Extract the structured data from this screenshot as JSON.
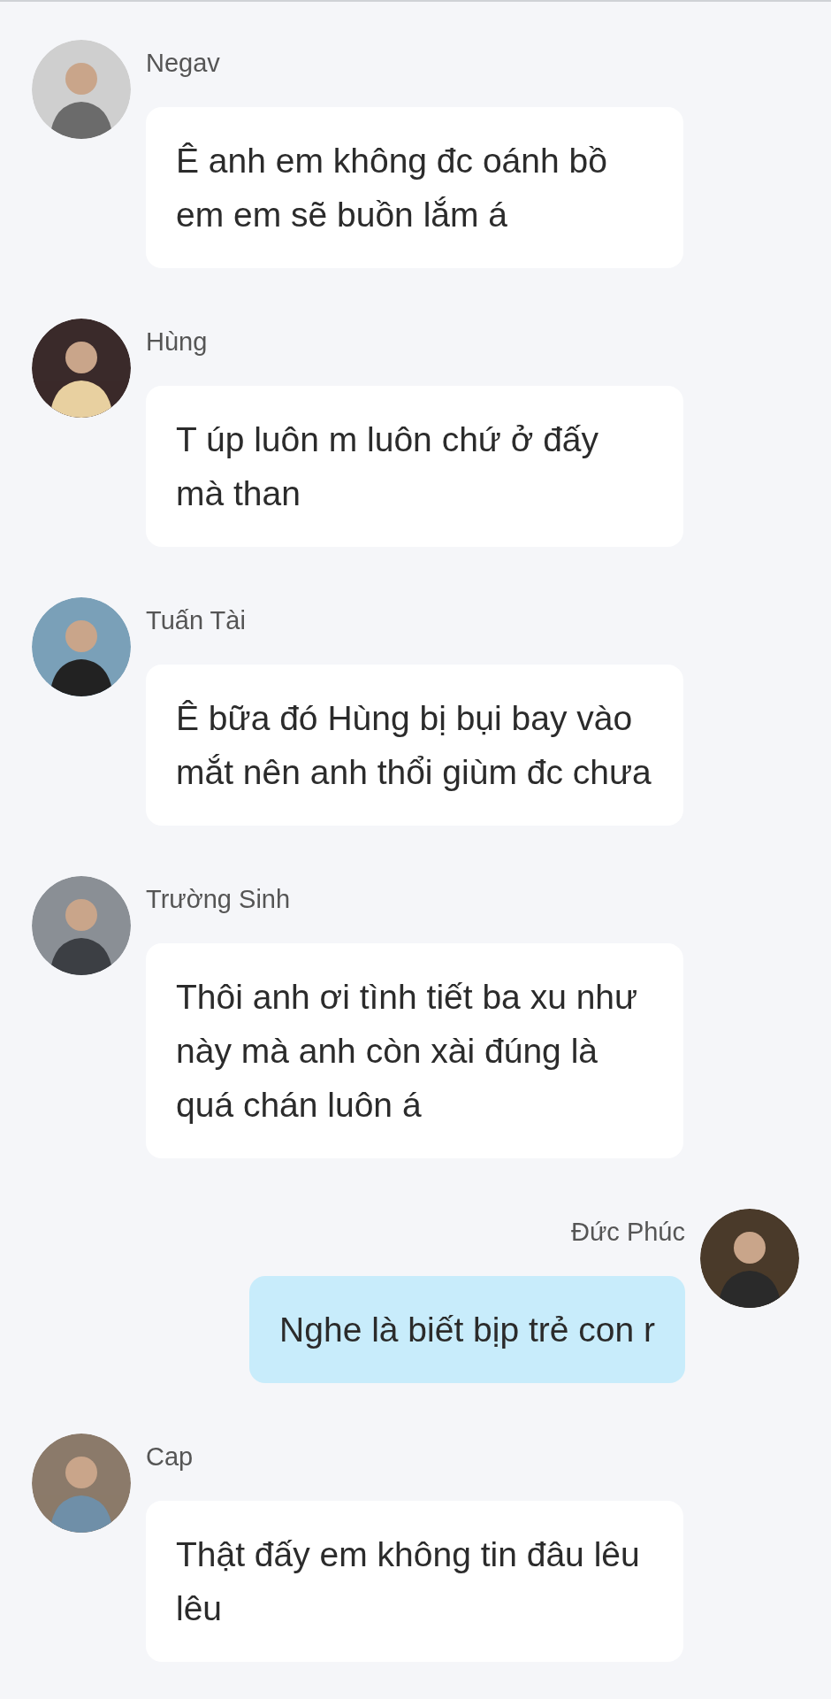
{
  "messages": [
    {
      "kind": "incoming",
      "name": "Negav",
      "text": "Ê anh em không đc oánh bồ em em sẽ buồn lắm á"
    },
    {
      "kind": "incoming",
      "name": "Hùng",
      "text": "T úp luôn m luôn chứ ở đấy mà than"
    },
    {
      "kind": "incoming",
      "name": "Tuấn Tài",
      "text": "Ê bữa đó Hùng bị bụi bay vào mắt nên anh thổi giùm đc chưa"
    },
    {
      "kind": "incoming",
      "name": "Trường Sinh",
      "text": "Thôi anh ơi tình tiết ba xu như này mà anh còn xài đúng là quá chán luôn á"
    },
    {
      "kind": "outgoing",
      "name": "Đức Phúc",
      "text": "Nghe là biết bịp trẻ con r"
    },
    {
      "kind": "incoming",
      "name": "Cap",
      "text": "Thật đấy em không tin đâu lêu lêu"
    }
  ]
}
